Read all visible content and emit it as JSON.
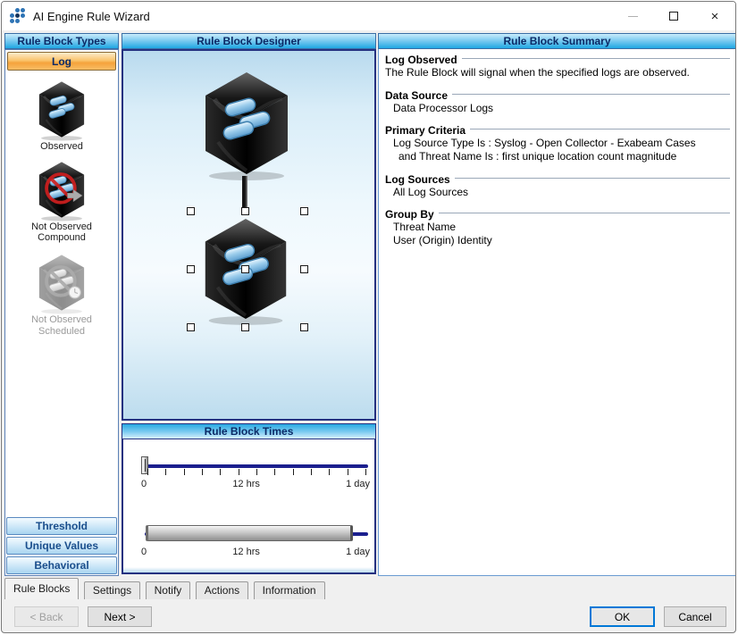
{
  "window": {
    "title": "AI Engine Rule Wizard",
    "controls": {
      "close_glyph": "×"
    }
  },
  "left_panel": {
    "header": "Rule Block Types",
    "log_button": "Log",
    "types": [
      {
        "line1": "Observed",
        "line2": ""
      },
      {
        "line1": "Not Observed",
        "line2": "Compound"
      },
      {
        "line1": "Not Observed",
        "line2": "Scheduled"
      }
    ],
    "bottom_buttons": [
      {
        "label": "Threshold"
      },
      {
        "label": "Unique Values"
      },
      {
        "label": "Behavioral"
      }
    ]
  },
  "designer": {
    "header": "Rule Block Designer"
  },
  "times": {
    "header": "Rule Block Times",
    "slider1": {
      "labels": [
        "0",
        "12 hrs",
        "1 day"
      ],
      "ticks": 13,
      "value": "0"
    },
    "slider2": {
      "labels": [
        "0",
        "12 hrs",
        "1 day"
      ]
    }
  },
  "summary": {
    "header": "Rule Block Summary",
    "sections": [
      {
        "title": "Log Observed",
        "lines": [
          "The Rule Block will signal when the specified logs are observed."
        ]
      },
      {
        "title": "Data Source",
        "lines": [
          "Data Processor Logs"
        ]
      },
      {
        "title": "Primary Criteria",
        "lines": [
          "Log Source Type Is : Syslog - Open Collector - Exabeam Cases",
          "and Threat Name Is : first unique location count magnitude"
        ]
      },
      {
        "title": "Log Sources",
        "lines": [
          "All Log Sources"
        ]
      },
      {
        "title": "Group By",
        "lines": [
          "Threat Name",
          "User (Origin) Identity"
        ]
      }
    ]
  },
  "tabs": [
    {
      "label": "Rule Blocks",
      "active": true
    },
    {
      "label": "Settings",
      "active": false
    },
    {
      "label": "Notify",
      "active": false
    },
    {
      "label": "Actions",
      "active": false
    },
    {
      "label": "Information",
      "active": false
    }
  ],
  "buttons": {
    "back": "< Back",
    "next": "Next >",
    "ok": "OK",
    "cancel": "Cancel"
  },
  "colors": {
    "header_blue": "#1ea7e3",
    "log_orange": "#f5a33c",
    "accent_navy": "#0c2a66",
    "track_navy": "#1b1f8e",
    "prohibit_red": "#cf1f1f"
  }
}
